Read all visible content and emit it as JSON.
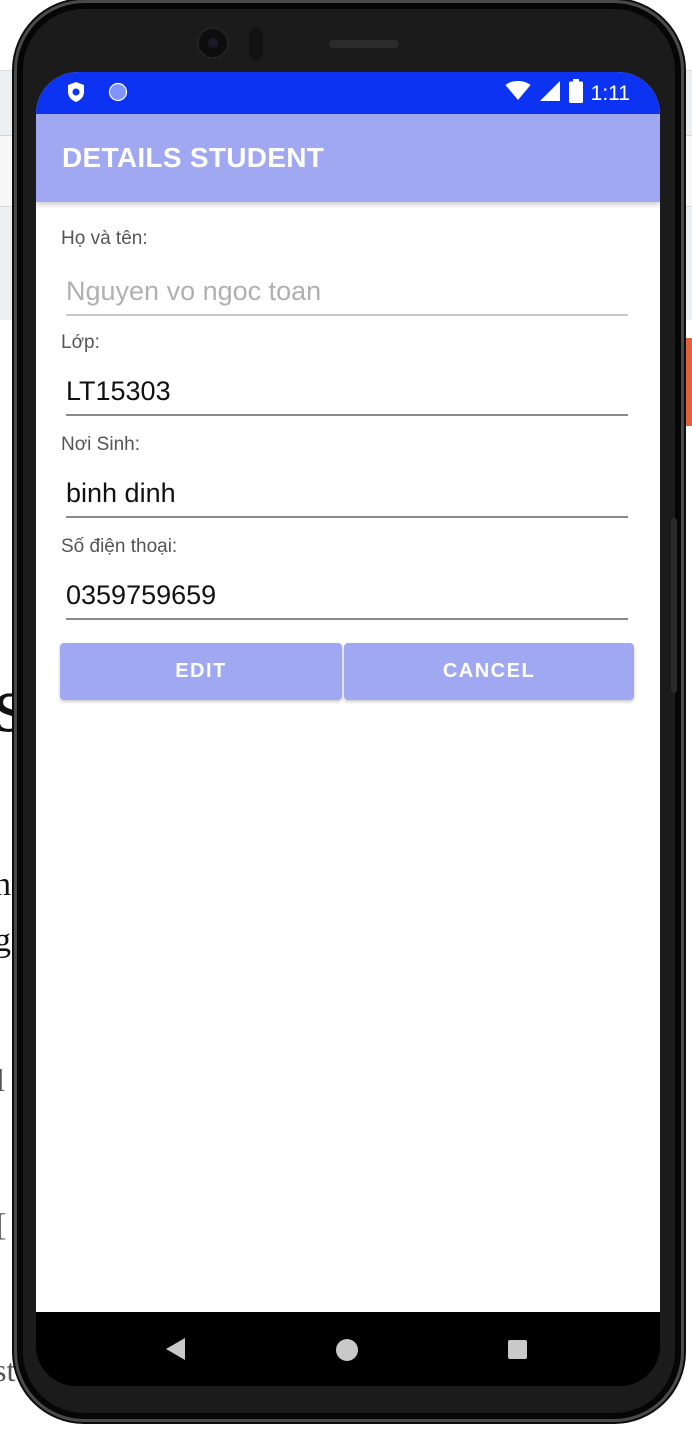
{
  "status_bar": {
    "time": "1:11",
    "icons": [
      "shield-icon",
      "circle-notification-icon",
      "wifi-icon",
      "signal-icon",
      "battery-icon"
    ],
    "color": "#0d33f2"
  },
  "app_bar": {
    "title": "DETAILS STUDENT",
    "color": "#9fa8f0"
  },
  "form": {
    "name_label": "Họ và tên:",
    "name_placeholder": "Nguyen vo ngoc toan",
    "name_value": "",
    "class_label": "Lớp:",
    "class_value": "LT15303",
    "birthplace_label": "Nơi Sinh:",
    "birthplace_value": "binh dinh",
    "phone_label": "Số điện thoại:",
    "phone_value": "0359759659"
  },
  "buttons": {
    "edit_label": "EDIT",
    "cancel_label": "CANCEL"
  },
  "nav_bar": {
    "icons": [
      "back-icon",
      "home-icon",
      "recent-apps-icon"
    ]
  },
  "background_page": {
    "glyphs": [
      "s",
      "n",
      "g",
      "l",
      "[",
      "st"
    ]
  }
}
